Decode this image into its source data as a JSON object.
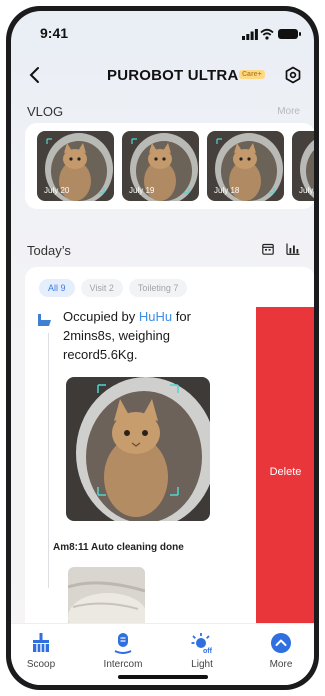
{
  "status_bar": {
    "time": "9:41"
  },
  "header": {
    "title": "PUROBOT ULTRA",
    "badge": "Care+"
  },
  "vlog": {
    "label": "VLOG",
    "more": "More",
    "items": [
      {
        "date": "July 20"
      },
      {
        "date": "July 19"
      },
      {
        "date": "July 18"
      },
      {
        "date": "July"
      }
    ]
  },
  "today": {
    "label": "Today’s",
    "tabs": [
      {
        "label": "All 9"
      },
      {
        "label": "Visit 2"
      },
      {
        "label": "Toileting 7"
      }
    ],
    "events": [
      {
        "prefix": "Occupied by ",
        "pet": "HuHu",
        "suffix": " for 2mins8s, weighing record5.6Kg."
      },
      {
        "text": "Am8:11 Auto cleaning done"
      }
    ],
    "delete_label": "Delete"
  },
  "tabbar": {
    "items": [
      {
        "label": "Scoop"
      },
      {
        "label": "Intercom"
      },
      {
        "label": "Light"
      },
      {
        "label": "More"
      }
    ]
  },
  "colors": {
    "accent": "#3b7be6",
    "delete": "#e8363b",
    "pet_name": "#3e8ee8"
  }
}
